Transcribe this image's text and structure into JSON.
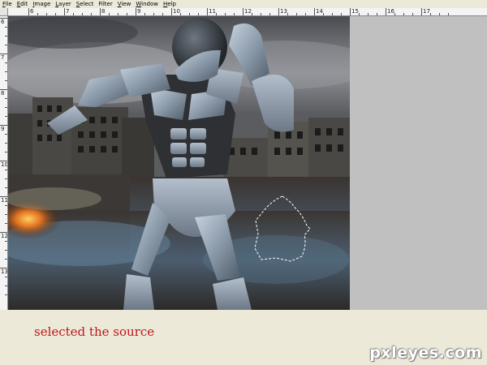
{
  "menu": {
    "items": [
      {
        "key": "F",
        "rest": "ile"
      },
      {
        "key": "E",
        "rest": "dit"
      },
      {
        "key": "I",
        "rest": "mage"
      },
      {
        "key": "L",
        "rest": "ayer"
      },
      {
        "key": "S",
        "rest": "elect"
      },
      {
        "key": "F",
        "rest": "ilter"
      },
      {
        "key": "V",
        "rest": "iew"
      },
      {
        "key": "W",
        "rest": "indow"
      },
      {
        "key": "H",
        "rest": "elp"
      }
    ]
  },
  "ruler_top": {
    "labels": [
      "6",
      "7",
      "8",
      "9",
      "10",
      "11",
      "12",
      "13",
      "14",
      "15",
      "16",
      "17"
    ]
  },
  "ruler_left": {
    "labels": [
      "6",
      "7",
      "8",
      "9",
      "10",
      "11",
      "12",
      "13"
    ]
  },
  "caption": "selected the source",
  "watermark": "pxleyes.com",
  "colors": {
    "caption": "#c0141c",
    "pasteboard": "#c0c0c0",
    "app_background": "#ece9d8"
  }
}
